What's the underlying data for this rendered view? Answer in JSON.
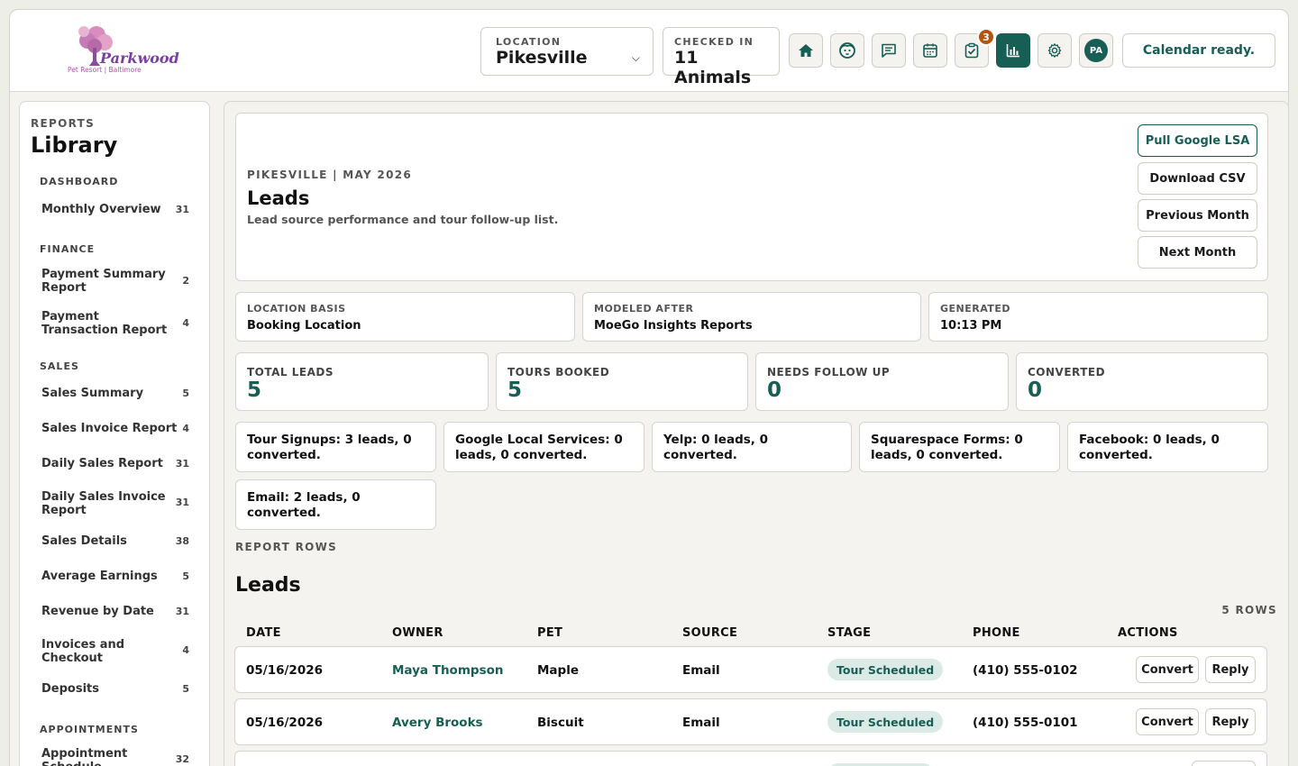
{
  "header": {
    "logo_text": "Parkwood",
    "logo_sub": "Pet Resort | Baltimore",
    "location_label": "LOCATION",
    "location_value": "Pikesville",
    "checked_label": "CHECKED IN",
    "checked_value": "11 Animals",
    "task_badge": "3",
    "avatar": "PA",
    "status": "Calendar ready.",
    "icons": [
      "home-icon",
      "pet-icon",
      "message-icon",
      "calendar-icon",
      "tasks-icon",
      "reports-icon",
      "settings-icon"
    ]
  },
  "sidebar": {
    "overline": "REPORTS",
    "title": "Library",
    "sections": [
      {
        "label": "DASHBOARD",
        "items": [
          {
            "label": "Monthly Overview",
            "count": "31"
          }
        ]
      },
      {
        "label": "FINANCE",
        "items": [
          {
            "label": "Payment Summary Report",
            "count": "2"
          },
          {
            "label": "Payment Transaction Report",
            "count": "4"
          }
        ]
      },
      {
        "label": "SALES",
        "items": [
          {
            "label": "Sales Summary",
            "count": "5"
          },
          {
            "label": "Sales Invoice Report",
            "count": "4"
          },
          {
            "label": "Daily Sales Report",
            "count": "31"
          },
          {
            "label": "Daily Sales Invoice Report",
            "count": "31"
          },
          {
            "label": "Sales Details",
            "count": "38"
          },
          {
            "label": "Average Earnings",
            "count": "5"
          },
          {
            "label": "Revenue by Date",
            "count": "31"
          },
          {
            "label": "Invoices and Checkout",
            "count": "4"
          },
          {
            "label": "Deposits",
            "count": "5"
          }
        ]
      },
      {
        "label": "APPOINTMENTS",
        "items": [
          {
            "label": "Appointment Schedule",
            "count": "32"
          }
        ]
      }
    ]
  },
  "report": {
    "eyebrow": "PIKESVILLE | MAY 2026",
    "title": "Leads",
    "subtitle": "Lead source performance and tour follow-up list.",
    "buttons": {
      "pull": "Pull Google LSA",
      "csv": "Download CSV",
      "prev": "Previous Month",
      "next": "Next Month"
    },
    "meta": [
      {
        "label": "LOCATION BASIS",
        "value": "Booking Location"
      },
      {
        "label": "MODELED AFTER",
        "value": "MoeGo Insights Reports"
      },
      {
        "label": "GENERATED",
        "value": "10:13 PM"
      }
    ],
    "stats": [
      {
        "label": "TOTAL LEADS",
        "value": "5"
      },
      {
        "label": "TOURS BOOKED",
        "value": "5"
      },
      {
        "label": "NEEDS FOLLOW UP",
        "value": "0"
      },
      {
        "label": "CONVERTED",
        "value": "0"
      }
    ],
    "sources": [
      "Tour Signups: 3 leads, 0 converted.",
      "Google Local Services: 0 leads, 0 converted.",
      "Yelp: 0 leads, 0 converted.",
      "Squarespace Forms: 0 leads, 0 converted.",
      "Facebook: 0 leads, 0 converted.",
      "Email: 2 leads, 0 converted."
    ],
    "rows_label": "REPORT ROWS",
    "table_title": "Leads",
    "row_count": "5 ROWS",
    "columns": [
      "DATE",
      "OWNER",
      "PET",
      "SOURCE",
      "STAGE",
      "PHONE",
      "ACTIONS"
    ],
    "rows": [
      {
        "date": "05/16/2026",
        "owner": "Maya Thompson",
        "pet": "Maple",
        "source": "Email",
        "stage": "Tour Scheduled",
        "phone": "(410) 555-0102"
      },
      {
        "date": "05/16/2026",
        "owner": "Avery Brooks",
        "pet": "Biscuit",
        "source": "Email",
        "stage": "Tour Scheduled",
        "phone": "(410) 555-0101"
      }
    ],
    "actions": {
      "convert": "Convert",
      "reply": "Reply"
    }
  }
}
